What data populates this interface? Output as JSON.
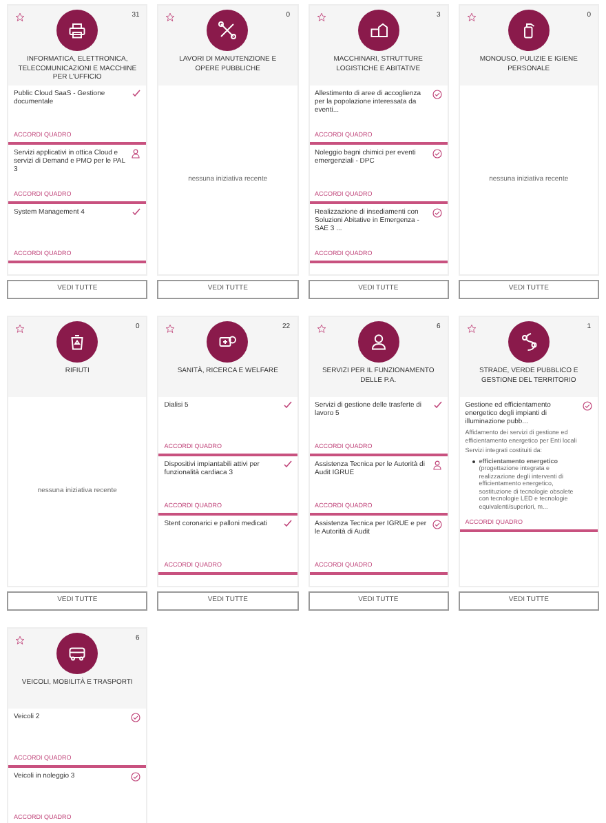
{
  "categories": [
    {
      "title": "INFORMATICA, ELETTRONICA, TELECOMUNICAZIONI E MACCHINE PER L'UFFICIO",
      "count": "31",
      "starred": false,
      "items": [
        {
          "title": "Public Cloud SaaS - Gestione documentale",
          "kind": "check",
          "link": "ACCORDI QUADRO"
        },
        {
          "title": "Servizi applicativi in ottica Cloud e servizi di Demand e PMO per le PAL 3",
          "kind": "person",
          "link": "ACCORDI QUADRO"
        },
        {
          "title": "System Management 4",
          "kind": "check",
          "link": "ACCORDI QUADRO"
        }
      ],
      "button": "VEDI TUTTE"
    },
    {
      "title": "LAVORI DI MANUTENZIONE E OPERE PUBBLICHE",
      "count": "0",
      "starred": false,
      "empty_text": "nessuna iniziativa recente",
      "button": "VEDI TUTTE"
    },
    {
      "title": "MACCHINARI, STRUTTURE LOGISTICHE E ABITATIVE",
      "count": "3",
      "starred": false,
      "items": [
        {
          "title": "Allestimento di aree di accoglienza per la popolazione interessata da eventi...",
          "kind": "circle",
          "link": "ACCORDI QUADRO"
        },
        {
          "title": "Noleggio bagni chimici per eventi emergenziali - DPC",
          "kind": "circle",
          "link": "ACCORDI QUADRO"
        },
        {
          "title": "Realizzazione di insediamenti con Soluzioni Abitative in Emergenza - SAE 3 ...",
          "kind": "circle",
          "link": "ACCORDI QUADRO"
        }
      ],
      "button": "VEDI TUTTE"
    },
    {
      "title": "MONOUSO, PULIZIE E IGIENE PERSONALE",
      "count": "0",
      "starred": false,
      "empty_text": "nessuna iniziativa recente",
      "button": "VEDI TUTTE"
    },
    {
      "title": "RIFIUTI",
      "count": "0",
      "starred": false,
      "empty_text": "nessuna iniziativa recente",
      "button": "VEDI TUTTE"
    },
    {
      "title": "SANITÀ, RICERCA E WELFARE",
      "count": "22",
      "starred": false,
      "items": [
        {
          "title": "Dialisi 5",
          "kind": "check",
          "link": "ACCORDI QUADRO"
        },
        {
          "title": "Dispositivi impiantabili attivi per funzionalità cardiaca 3",
          "kind": "check",
          "link": "ACCORDI QUADRO"
        },
        {
          "title": "Stent coronarici e palloni medicati",
          "kind": "check",
          "link": "ACCORDI QUADRO"
        }
      ],
      "button": "VEDI TUTTE"
    },
    {
      "title": "SERVIZI PER IL FUNZIONAMENTO DELLE P.A.",
      "count": "6",
      "starred": false,
      "items": [
        {
          "title": "Servizi di gestione delle trasferte di lavoro 5",
          "kind": "check",
          "link": "ACCORDI QUADRO"
        },
        {
          "title": "Assistenza Tecnica per le Autorità di Audit IGRUE",
          "kind": "person",
          "link": "ACCORDI QUADRO"
        },
        {
          "title": "Assistenza Tecnica per IGRUE e per le Autorità di Audit",
          "kind": "circle",
          "link": "ACCORDI QUADRO"
        }
      ],
      "button": "VEDI TUTTE"
    },
    {
      "title": "STRADE, VERDE PUBBLICO E GESTIONE DEL TERRITORIO",
      "count": "1",
      "starred": false,
      "items": [
        {
          "title": "Gestione ed efficientamento energetico degli impianti di illuminazione pubb...",
          "kind": "circle",
          "link": "ACCORDI QUADRO",
          "details": [
            "Affidamento dei servizi di gestione ed efficientamento energetico per Enti locali",
            "Servizi integrati costituiti da:"
          ],
          "bullets": [
            "**efficientamento energetico** (progettazione integrata e realizzazione degli interventi di efficientamento energetico, sostituzione di tecnologie obsolete con tecnologie LED e tecnologie equivalenti/superiori, m..."
          ]
        }
      ],
      "button": "VEDI TUTTE"
    },
    {
      "title": "VEICOLI, MOBILITÀ E TRASPORTI",
      "count": "6",
      "starred": false,
      "items": [
        {
          "title": "Veicoli 2",
          "kind": "circle",
          "link": "ACCORDI QUADRO"
        },
        {
          "title": "Veicoli in noleggio 3",
          "kind": "circle",
          "link": "ACCORDI QUADRO"
        }
      ]
    }
  ]
}
